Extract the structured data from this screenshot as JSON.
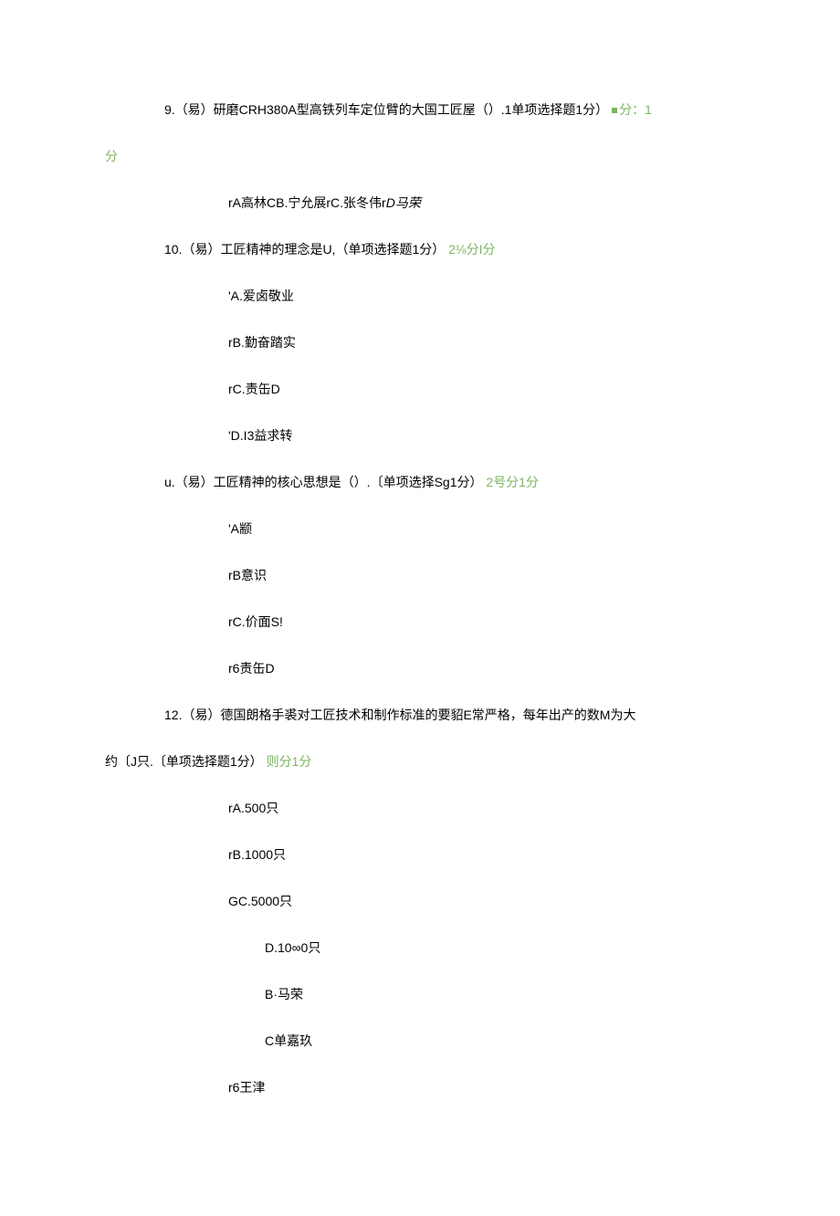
{
  "q9": {
    "prefix": "9.（易）研磨CRH380A型高铁列车定位臂的大国工匠屋（）.1单项选择题1分）",
    "score1": "分：1",
    "score2": "分",
    "options_line": {
      "a_pre": "r",
      "a": "A高林C",
      "b": "B.宁允展",
      "c_pre": "r",
      "c": "C.张冬伟",
      "d_pre": "r",
      "d_italic": "D马荣"
    }
  },
  "q10": {
    "stem": "10.（易）工匠精神的理念是U,（单项选择题1分）",
    "score": "2⅛分I分",
    "opts": {
      "a": "'A.爱卤敬业",
      "b": "rB.勤奋踏实",
      "c": "rC.责缶D",
      "d": "'D.I3益求转"
    }
  },
  "q11": {
    "stem": "u.（易）工匠精神的核心思想是（）.〔单项选择Sg1分）",
    "score": "2号分1分",
    "opts": {
      "a": "'A颛",
      "b": "rB意识",
      "c": "rC.价面S!",
      "d": "r6责缶D"
    }
  },
  "q12": {
    "line1": "12.（易）德国朗格手裘对工匠技术和制作标准的要貂E常严格，每年出产的数M为大",
    "line2_pre": "约〔J只.〔单项选择题1分）",
    "line2_score": "则分1分",
    "opts": {
      "a": "rA.500只",
      "b": "rB.1000只",
      "c": "GC.5000只",
      "d": "D.10∞0只",
      "e": "B·马荣",
      "f": "C单嘉玖",
      "g": "r6王津"
    }
  }
}
